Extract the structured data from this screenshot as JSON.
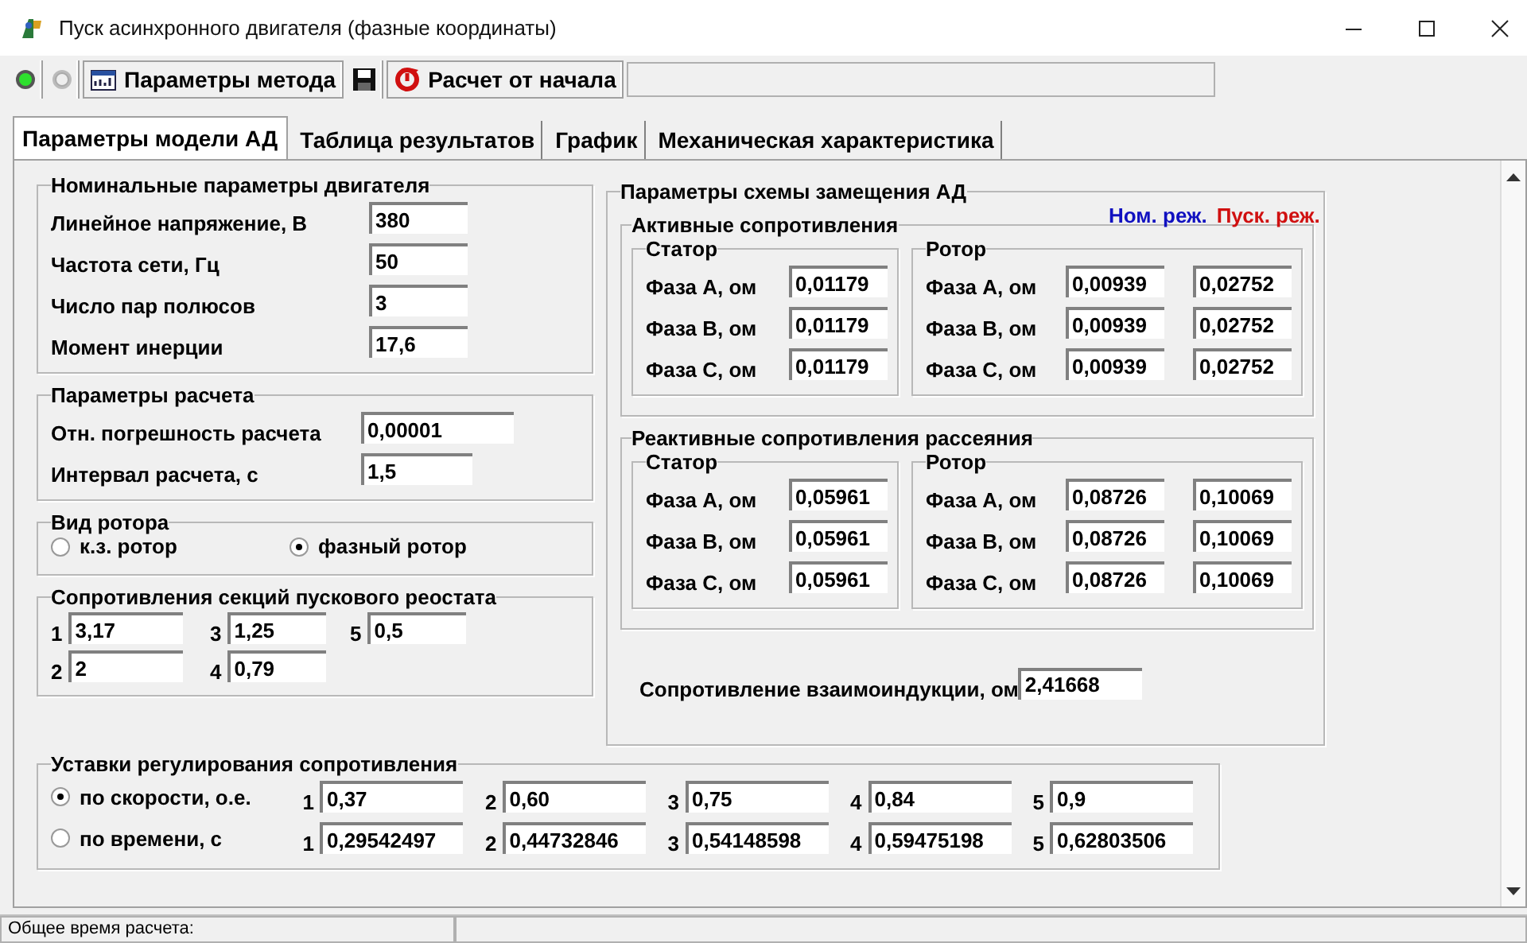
{
  "window": {
    "title": "Пуск асинхронного двигателя (фазные координаты)"
  },
  "toolbar": [
    {
      "kind": "led",
      "on": true
    },
    {
      "kind": "led",
      "on": false
    },
    {
      "kind": "method",
      "label": "Параметры метода"
    },
    {
      "kind": "save"
    },
    {
      "kind": "restart",
      "label": "Расчет от начала"
    }
  ],
  "tabs": [
    {
      "label": "Параметры модели АД",
      "selected": true
    },
    {
      "label": "Таблица результатов",
      "selected": false
    },
    {
      "label": "График",
      "selected": false
    },
    {
      "label": "Механическая характеристика",
      "selected": false
    }
  ],
  "nominal": {
    "title": "Номинальные параметры двигателя",
    "rows": [
      {
        "label": "Линейное напряжение, В",
        "value": "380"
      },
      {
        "label": "Частота сети, Гц",
        "value": "50"
      },
      {
        "label": "Число пар полюсов",
        "value": "3"
      },
      {
        "label": "Момент инерции",
        "value": "17,6"
      }
    ]
  },
  "calculation": {
    "title": "Параметры расчета",
    "rows": [
      {
        "label": "Отн. погрешность расчета",
        "value": "0,00001"
      },
      {
        "label": "Интервал расчета, с",
        "value": "1,5"
      }
    ]
  },
  "rotor_type": {
    "title": "Вид ротора",
    "options": [
      {
        "label": "к.з. ротор",
        "selected": false
      },
      {
        "label": "фазный ротор",
        "selected": true
      }
    ]
  },
  "rheostat": {
    "title": "Сопротивления секций пускового реостата",
    "sections": [
      {
        "number": "1",
        "value": "3,17"
      },
      {
        "number": "2",
        "value": "2"
      },
      {
        "number": "3",
        "value": "1,25"
      },
      {
        "number": "4",
        "value": "0,79"
      },
      {
        "number": "5",
        "value": "0,5"
      }
    ]
  },
  "scheme": {
    "title": "Параметры схемы замещения АД",
    "legend": [
      {
        "label": "Ном. реж.",
        "color": "#1010c0"
      },
      {
        "label": "Пуск. реж.",
        "color": "#d01010"
      }
    ],
    "groups": [
      {
        "title": "Активные сопротивления",
        "stator": {
          "title": "Статор",
          "rows": [
            {
              "label": "Фаза А, ом",
              "value": "0,01179"
            },
            {
              "label": "Фаза В, ом",
              "value": "0,01179"
            },
            {
              "label": "Фаза С, ом",
              "value": "0,01179"
            }
          ]
        },
        "rotor": {
          "title": "Ротор",
          "rows": [
            {
              "label": "Фаза А, ом",
              "nominal": "0,00939",
              "starting": "0,02752"
            },
            {
              "label": "Фаза В, ом",
              "nominal": "0,00939",
              "starting": "0,02752"
            },
            {
              "label": "Фаза С, ом",
              "nominal": "0,00939",
              "starting": "0,02752"
            }
          ]
        }
      },
      {
        "title": "Реактивные сопротивления рассеяния",
        "stator": {
          "title": "Статор",
          "rows": [
            {
              "label": "Фаза А, ом",
              "value": "0,05961"
            },
            {
              "label": "Фаза В, ом",
              "value": "0,05961"
            },
            {
              "label": "Фаза С, ом",
              "value": "0,05961"
            }
          ]
        },
        "rotor": {
          "title": "Ротор",
          "rows": [
            {
              "label": "Фаза А, ом",
              "nominal": "0,08726",
              "starting": "0,10069"
            },
            {
              "label": "Фаза В, ом",
              "nominal": "0,08726",
              "starting": "0,10069"
            },
            {
              "label": "Фаза С, ом",
              "nominal": "0,08726",
              "starting": "0,10069"
            }
          ]
        }
      }
    ],
    "mutual": {
      "label": "Сопротивление взаимоиндукции, ом",
      "value": "2,41668"
    }
  },
  "regulation": {
    "title": "Уставки регулирования сопротивления",
    "rows": [
      {
        "label": "по скорости, о.е.",
        "selected": true,
        "cells": [
          {
            "number": "1",
            "value": "0,37"
          },
          {
            "number": "2",
            "value": "0,60"
          },
          {
            "number": "3",
            "value": "0,75"
          },
          {
            "number": "4",
            "value": "0,84"
          },
          {
            "number": "5",
            "value": "0,9"
          }
        ]
      },
      {
        "label": "по времени, с",
        "selected": false,
        "cells": [
          {
            "number": "1",
            "value": "0,29542497"
          },
          {
            "number": "2",
            "value": "0,44732846"
          },
          {
            "number": "3",
            "value": "0,54148598"
          },
          {
            "number": "4",
            "value": "0,59475198"
          },
          {
            "number": "5",
            "value": "0,62803506"
          }
        ]
      }
    ]
  },
  "status_bar": {
    "label": "Общее время расчета:"
  }
}
